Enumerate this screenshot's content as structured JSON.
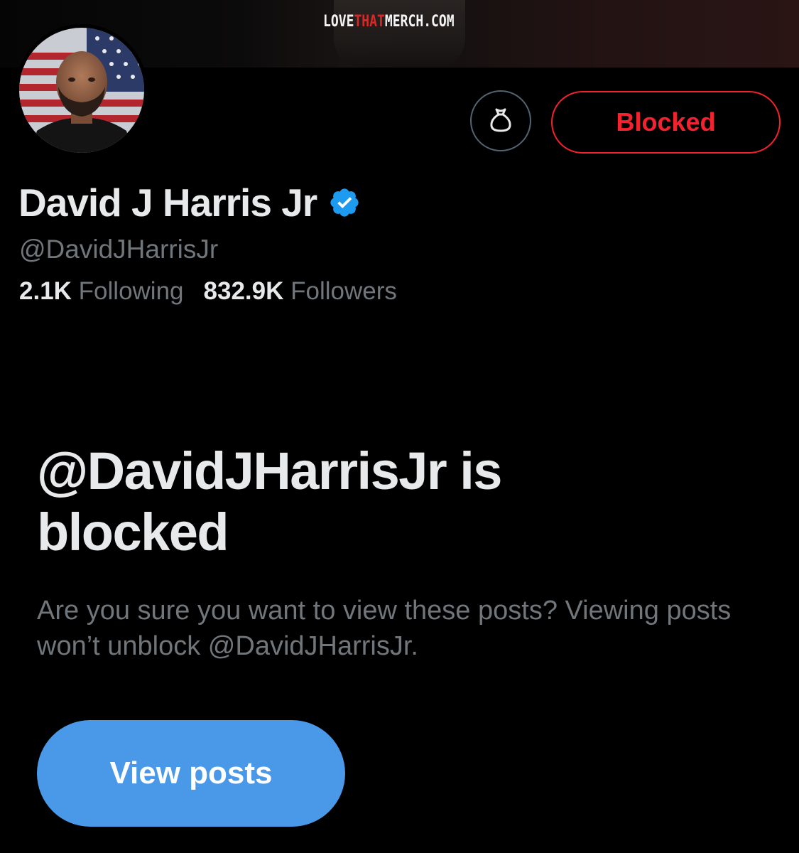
{
  "banner": {
    "brand_prefix": "LOVE",
    "brand_accent": "THAT",
    "brand_suffix": "MERCH.COM"
  },
  "profile": {
    "display_name": "David J Harris Jr",
    "handle": "@DavidJHarrisJr",
    "verified_icon": "verified-badge-icon",
    "following_count": "2.1K",
    "following_label": "Following",
    "followers_count": "832.9K",
    "followers_label": "Followers"
  },
  "actions": {
    "tip_icon": "money-bag-icon",
    "blocked_label": "Blocked"
  },
  "blocked_notice": {
    "title": "@DavidJHarrisJr is blocked",
    "description": "Are you sure you want to view these posts? Viewing posts won’t unblock @DavidJHarrisJr.",
    "view_button": "View posts"
  },
  "colors": {
    "background": "#000000",
    "primary_text": "#e7e9ea",
    "secondary_text": "#71767b",
    "blocked_red": "#f4212e",
    "accent_blue": "#4a99e9",
    "verified_blue": "#1d9bf0"
  }
}
